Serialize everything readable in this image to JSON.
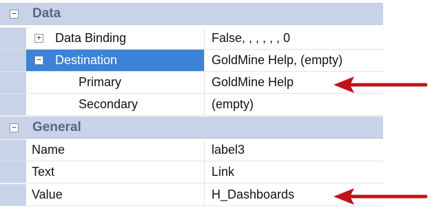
{
  "categories": {
    "data": {
      "label": "Data",
      "toggle": "−"
    },
    "general": {
      "label": "General",
      "toggle": "−"
    }
  },
  "rows": {
    "data_binding": {
      "name": "Data Binding",
      "value": "False, , , , , , 0",
      "toggle": "+"
    },
    "destination": {
      "name": "Destination",
      "value": "GoldMine Help, (empty)",
      "toggle": "−"
    },
    "primary": {
      "name": "Primary",
      "value": "GoldMine Help"
    },
    "secondary": {
      "name": "Secondary",
      "value": "(empty)"
    },
    "name": {
      "name": "Name",
      "value": "label3"
    },
    "text": {
      "name": "Text",
      "value": "Link"
    },
    "value": {
      "name": "Value",
      "value": "H_Dashboards"
    }
  },
  "icons": {
    "annotation_arrow": "arrow-left-icon"
  },
  "colors": {
    "arrow": "#c0141a",
    "selection": "#3a83d6",
    "category": "#c9d3e8"
  }
}
